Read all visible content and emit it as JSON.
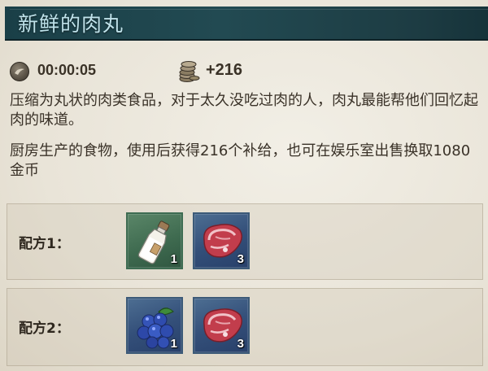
{
  "header": {
    "title": "新鲜的肉丸"
  },
  "stats": {
    "time": "00:00:05",
    "supply": "+216"
  },
  "description": {
    "line1": "压缩为丸状的肉类食品，对于太久没吃过肉的人，肉丸最能帮他们回忆起肉的味道。",
    "line2": "厨房生产的食物，使用后获得216个补给，也可在娱乐室出售换取1080金币"
  },
  "recipes": [
    {
      "label": "配方1：",
      "ingredients": [
        {
          "icon": "milk-bottle-icon",
          "quantity": "1",
          "frame": "green"
        },
        {
          "icon": "raw-steak-icon",
          "quantity": "3",
          "frame": "blue"
        }
      ]
    },
    {
      "label": "配方2：",
      "ingredients": [
        {
          "icon": "blueberries-icon",
          "quantity": "1",
          "frame": "blue"
        },
        {
          "icon": "raw-steak-icon",
          "quantity": "3",
          "frame": "blue"
        }
      ]
    }
  ],
  "colors": {
    "header_bg": "#1d4249",
    "title_text": "#bfe2ea",
    "blue_frame": "#34507a",
    "green_frame": "#3f6b50"
  }
}
